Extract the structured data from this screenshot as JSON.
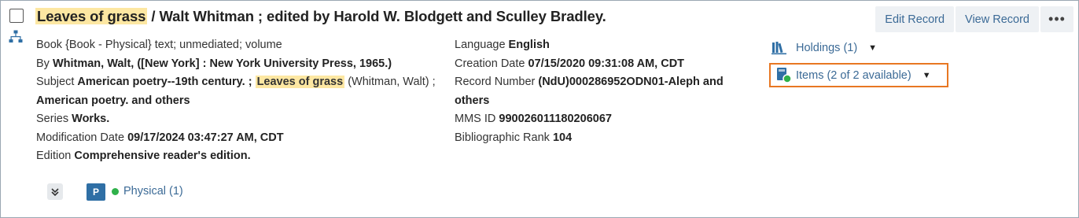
{
  "record": {
    "title_highlight": "Leaves of grass",
    "title_rest": "/ Walt Whitman ; edited by Harold W. Blodgett and Sculley Bradley."
  },
  "actions": {
    "edit_label": "Edit Record",
    "view_label": "View Record",
    "more_label": "•••"
  },
  "details_left": {
    "format_label": "Book",
    "format_value": "{Book - Physical} text; unmediated; volume",
    "by_label": "By",
    "by_value": "Whitman, Walt, ([New York] : New York University Press, 1965.)",
    "subject_label": "Subject",
    "subject_part1": "American poetry--19th century. ;",
    "subject_highlight": "Leaves of grass",
    "subject_part2": "(Whitman, Walt) ;",
    "subject_part3": "American poetry. and others",
    "series_label": "Series",
    "series_value": "Works.",
    "modification_label": "Modification Date",
    "modification_value": "09/17/2024 03:47:27 AM, CDT",
    "edition_label": "Edition",
    "edition_value": "Comprehensive reader's edition."
  },
  "details_right": {
    "language_label": "Language",
    "language_value": "English",
    "creation_label": "Creation Date",
    "creation_value": "07/15/2020 09:31:08 AM, CDT",
    "record_number_label": "Record Number",
    "record_number_value": "(NdU)000286952ODN01-Aleph and",
    "record_number_value2": "others",
    "mms_label": "MMS ID",
    "mms_value": "990026011180206067",
    "rank_label": "Bibliographic Rank",
    "rank_value": "104"
  },
  "side": {
    "holdings_label": "Holdings (1)",
    "items_label": "Items (2 of 2 available)",
    "caret": "▼"
  },
  "footer": {
    "badge": "P",
    "physical_label": "Physical (1)"
  },
  "colors": {
    "highlight": "#fde7a2",
    "link": "#3b6a96",
    "available": "#2fb14a",
    "focus_outline": "#e87722",
    "badge": "#2f6fa5"
  }
}
